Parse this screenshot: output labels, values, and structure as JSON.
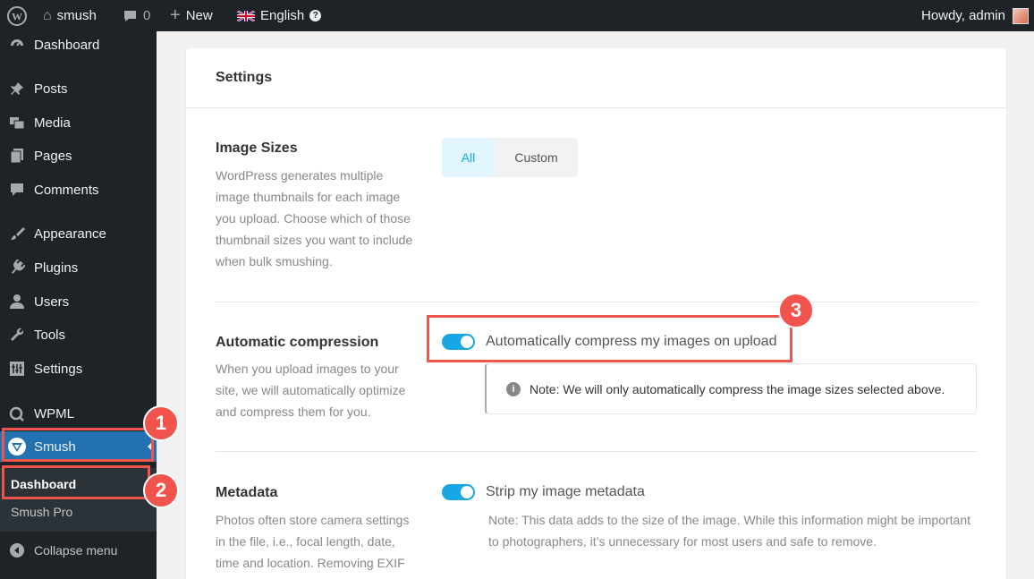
{
  "adminbar": {
    "site_name": "smush",
    "comments_count": "0",
    "new_label": "New",
    "language": "English",
    "howdy": "Howdy, admin"
  },
  "sidebar": {
    "items": [
      {
        "label": "Dashboard",
        "icon": "dashboard-icon"
      },
      {
        "label": "Posts",
        "icon": "pin-icon"
      },
      {
        "label": "Media",
        "icon": "media-icon"
      },
      {
        "label": "Pages",
        "icon": "pages-icon"
      },
      {
        "label": "Comments",
        "icon": "comment-icon"
      },
      {
        "label": "Appearance",
        "icon": "brush-icon"
      },
      {
        "label": "Plugins",
        "icon": "plugin-icon"
      },
      {
        "label": "Users",
        "icon": "user-icon"
      },
      {
        "label": "Tools",
        "icon": "wrench-icon"
      },
      {
        "label": "Settings",
        "icon": "settings-icon"
      },
      {
        "label": "WPML",
        "icon": "wpml-icon"
      },
      {
        "label": "Smush",
        "icon": "smush-icon"
      }
    ],
    "submenu": [
      {
        "label": "Dashboard"
      },
      {
        "label": "Smush Pro"
      }
    ],
    "collapse_label": "Collapse menu"
  },
  "card": {
    "title": "Settings",
    "image_sizes": {
      "title": "Image Sizes",
      "description": "WordPress generates multiple image thumbnails for each image you upload. Choose which of those thumbnail sizes you want to include when bulk smushing.",
      "options": [
        "All",
        "Custom"
      ],
      "selected": "All"
    },
    "auto_compression": {
      "title": "Automatic compression",
      "description": "When you upload images to your site, we will automatically optimize and compress them for you.",
      "toggle_label": "Automatically compress my images on upload",
      "enabled": true,
      "notice": "Note: We will only automatically compress the image sizes selected above."
    },
    "metadata": {
      "title": "Metadata",
      "description": "Photos often store camera settings in the file, i.e., focal length, date, time and location. Removing EXIF",
      "toggle_label": "Strip my image metadata",
      "enabled": true,
      "note": "Note: This data adds to the size of the image. While this information might be important to photographers, it’s unnecessary for most users and safe to remove."
    }
  },
  "callouts": [
    "1",
    "2",
    "3"
  ],
  "colors": {
    "accent": "#17a8e3",
    "highlight": "#f0544d",
    "admin_bg": "#1d2327",
    "active_menu": "#2271b1"
  }
}
